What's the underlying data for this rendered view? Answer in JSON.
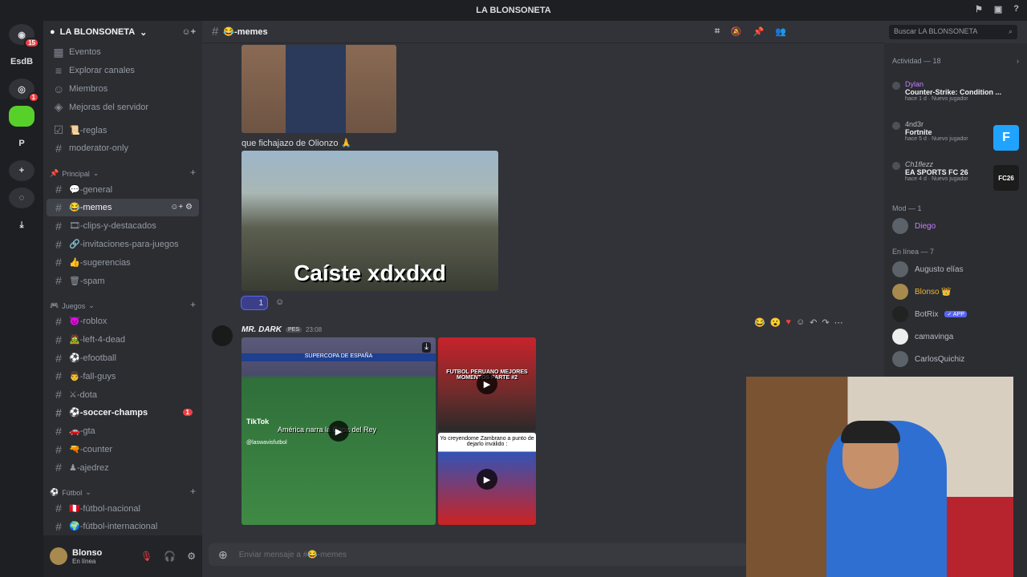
{
  "titlebar": {
    "title": "LA BLONSONETA"
  },
  "servers": [
    {
      "label": "15",
      "type": "home"
    },
    {
      "label": "EsdB",
      "type": "text"
    },
    {
      "label": "1",
      "type": "server"
    },
    {
      "label": "",
      "type": "green"
    },
    {
      "label": "P",
      "type": "text"
    },
    {
      "label": "+",
      "type": "add"
    }
  ],
  "guild": {
    "name": "LA BLONSONETA"
  },
  "sidebar": {
    "top": [
      "Eventos",
      "Explorar canales",
      "Miembros",
      "Mejoras del servidor"
    ],
    "channels": [
      "📜-reglas",
      "moderator-only"
    ],
    "cat1": "Principal",
    "principal": [
      "💬-general",
      "😂-memes",
      "🎞-clips-y-destacados",
      "🔗-invitaciones-para-juegos",
      "👍-sugerencias",
      "🗑-spam"
    ],
    "cat2": "Juegos",
    "juegos": [
      "😈-roblox",
      "🧟-left-4-dead",
      "⚽-efootball",
      "👨-fall-guys",
      "⚔-dota",
      "⚽-soccer-champs",
      "🚗-gta",
      "🔫-counter",
      "♟-ajedrez"
    ],
    "soccer_count": "1",
    "cat3": "Fútbol",
    "futbol": [
      "🇵🇪-fútbol-nacional",
      "🌍-fútbol-internacional"
    ]
  },
  "user": {
    "name": "Blonso",
    "status": "En línea"
  },
  "header": {
    "channel": "😂-memes",
    "search_placeholder": "Buscar LA BLONSONETA"
  },
  "chat": {
    "msg1_text": "que fichajazo de Olionzo 🙏",
    "meme_caption": "Caíste xdxdxd",
    "reaction_count": "1",
    "msg2_author": "MR. DARK",
    "msg2_tag": "PES",
    "msg2_time": "23:08",
    "vid1_caption": "América narra la Copa del Rey",
    "vid1_brand": "TikTok",
    "vid1_handle": "@laswavisfutbol",
    "vid1_banner": "SUPERCOPA DE ESPAÑA",
    "vid2_caption": "FUTBOL PERUANO MEJORES MOMENTOS PARTE #2",
    "vid3_caption": "Yo creyendome Zambrano a punto de dejarlo inválido :",
    "input_placeholder": "Enviar mensaje a #😂-memes"
  },
  "members": {
    "activity_title": "Actividad — 18",
    "activities": [
      {
        "user": "Dylan",
        "game": "Counter-Strike: Condition ...",
        "meta": "hace 1 d · Nuevo jugador",
        "thumb": ""
      },
      {
        "user": "4nd3r",
        "game": "Fortnite",
        "meta": "hace 5 d · Nuevo jugador",
        "thumb": "F"
      },
      {
        "user": "Ch1flezz",
        "game": "EA SPORTS FC 26",
        "meta": "hace 4 d · Nuevo jugador",
        "thumb": "FC26"
      }
    ],
    "mod_title": "Mod — 1",
    "mods": [
      "Diego"
    ],
    "online_title": "En línea — 7",
    "online": [
      "Augusto elías",
      "Blonso 👑",
      "BotRix",
      "camavinga",
      "CarlosQuichiz"
    ],
    "app_badge": "✓ APP"
  }
}
